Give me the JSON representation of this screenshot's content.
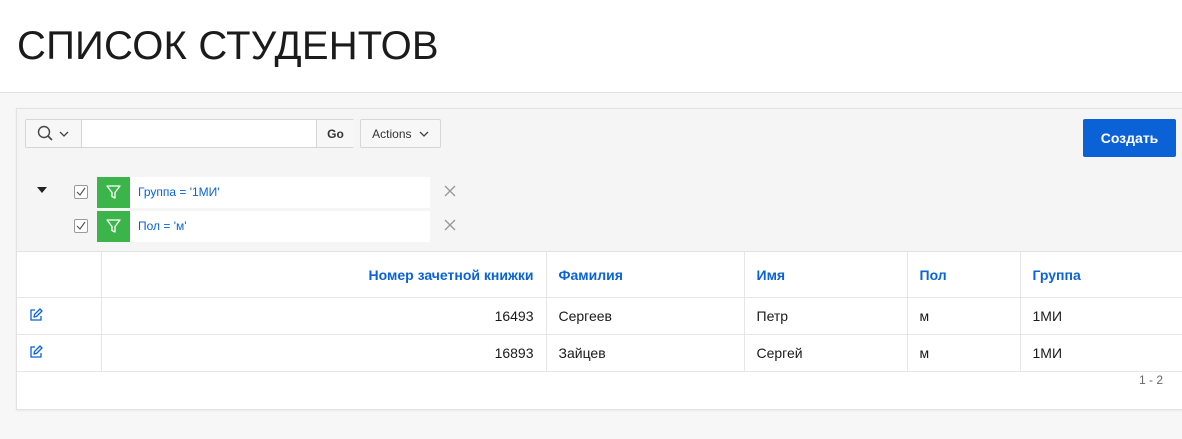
{
  "page": {
    "title": "СПИСОК СТУДЕНТОВ"
  },
  "toolbar": {
    "search_placeholder": "",
    "search_value": "",
    "go_label": "Go",
    "actions_label": "Actions",
    "create_label": "Создать"
  },
  "filters": [
    {
      "label": "Группа = '1МИ'",
      "checked": true
    },
    {
      "label": "Пол = 'м'",
      "checked": true
    }
  ],
  "table": {
    "columns": [
      "Номер зачетной книжки",
      "Фамилия",
      "Имя",
      "Пол",
      "Группа"
    ],
    "rows": [
      {
        "number": "16493",
        "surname": "Сергеев",
        "name": "Петр",
        "gender": "м",
        "group": "1МИ"
      },
      {
        "number": "16893",
        "surname": "Зайцев",
        "name": "Сергей",
        "gender": "м",
        "group": "1МИ"
      }
    ]
  },
  "pagination": {
    "label": "1 - 2"
  },
  "colors": {
    "accent": "#0b62d6",
    "filter_green": "#3bb54a"
  },
  "icons": [
    "search-icon",
    "chevron-down-icon",
    "collapse-triangle-icon",
    "checkbox-checked-icon",
    "filter-funnel-icon",
    "close-icon",
    "edit-icon"
  ]
}
